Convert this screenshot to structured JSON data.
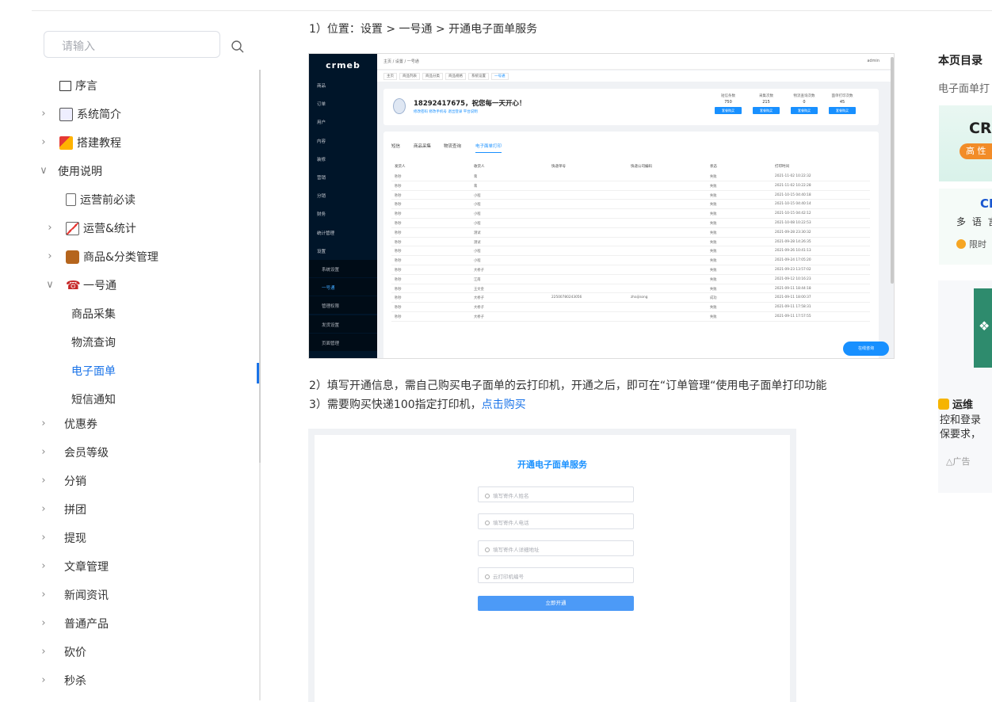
{
  "search": {
    "placeholder": "请输入"
  },
  "sidebar": {
    "items": [
      {
        "label": "序言",
        "icon": "book-icon",
        "chevron": ""
      },
      {
        "label": "系统简介",
        "icon": "document-icon",
        "chevron": ">"
      },
      {
        "label": "搭建教程",
        "icon": "construction-icon",
        "chevron": ">"
      },
      {
        "label": "使用说明",
        "icon": "",
        "chevron": "v"
      },
      {
        "label": "运营前必读",
        "icon": "page-icon",
        "chevron": ""
      },
      {
        "label": "运营&统计",
        "icon": "chart-icon",
        "chevron": ">"
      },
      {
        "label": "商品&分类管理",
        "icon": "box-icon",
        "chevron": ">"
      },
      {
        "label": "一号通",
        "icon": "phone-icon",
        "chevron": "v"
      },
      {
        "label": "商品采集",
        "icon": "",
        "chevron": ""
      },
      {
        "label": "物流查询",
        "icon": "",
        "chevron": ""
      },
      {
        "label": "电子面单",
        "icon": "",
        "chevron": "",
        "active": true
      },
      {
        "label": "短信通知",
        "icon": "",
        "chevron": ""
      },
      {
        "label": "优惠券",
        "icon": "",
        "chevron": ">"
      },
      {
        "label": "会员等级",
        "icon": "",
        "chevron": ">"
      },
      {
        "label": "分销",
        "icon": "",
        "chevron": ">"
      },
      {
        "label": "拼团",
        "icon": "",
        "chevron": ">"
      },
      {
        "label": "提现",
        "icon": "",
        "chevron": ">"
      },
      {
        "label": "文章管理",
        "icon": "",
        "chevron": ">"
      },
      {
        "label": "新闻资讯",
        "icon": "",
        "chevron": ">"
      },
      {
        "label": "普通产品",
        "icon": "",
        "chevron": ">"
      },
      {
        "label": "砍价",
        "icon": "",
        "chevron": ">"
      },
      {
        "label": "秒杀",
        "icon": "",
        "chevron": ">"
      }
    ]
  },
  "content": {
    "step1": "1）位置：设置 > 一号通 > 开通电子面单服务",
    "step2": "2）填写开通信息，需自己购买电子面单的云打印机，开通之后，即可在“订单管理“使用电子面单打印功能",
    "step3_prefix": "3）需要购买快递100指定打印机，",
    "step3_link": "点击购买"
  },
  "screenshot": {
    "logo": "crmeb",
    "breadcrumb": "主页 / 设置 / 一号通",
    "user": "admin",
    "tabs": [
      "主页",
      "商品列表",
      "商品分类",
      "商品规格",
      "系统设置",
      "一号通"
    ],
    "menu": [
      "商品",
      "订单",
      "用户",
      "内容",
      "装修",
      "营销",
      "分销",
      "财务",
      "统计管理",
      "设置",
      "系统设置",
      "一号通",
      "管理权限",
      "发货设置",
      "页面管理",
      "维护"
    ],
    "greeting": "18292417675，祝您每一天开心！",
    "links": "修改密码  修改手机号  退出登录  平台说明",
    "stats": [
      {
        "label": "短信条数",
        "value": "750",
        "button": "套餐购买"
      },
      {
        "label": "采集次数",
        "value": "215",
        "button": "套餐购买"
      },
      {
        "label": "物流查询次数",
        "value": "0",
        "button": "套餐购买"
      },
      {
        "label": "面单打印次数",
        "value": "45",
        "button": "套餐购买"
      }
    ],
    "content_tabs": [
      "短信",
      "商品采集",
      "物流查询",
      "电子面单打印"
    ],
    "table_headers": [
      "发货人",
      "收货人",
      "快递单号",
      "快递公司编码",
      "状态",
      "打印时间"
    ],
    "rows": [
      [
        "秒秒",
        "蒋",
        "",
        "",
        "失败",
        "2021-11-02 10:22:32"
      ],
      [
        "秒秒",
        "蒋",
        "",
        "",
        "失败",
        "2021-11-02 10:22:28"
      ],
      [
        "秒秒",
        "小程",
        "",
        "",
        "失败",
        "2021-10-15 04:40:18"
      ],
      [
        "秒秒",
        "小程",
        "",
        "",
        "失败",
        "2021-10-15 04:40:14"
      ],
      [
        "秒秒",
        "小程",
        "",
        "",
        "失败",
        "2021-10-15 04:42:12"
      ],
      [
        "秒秒",
        "小程",
        "",
        "",
        "失败",
        "2021-10-08 10:22:53"
      ],
      [
        "秒秒",
        "测试",
        "",
        "",
        "失败",
        "2021-09-28 23:30:32"
      ],
      [
        "秒秒",
        "测试",
        "",
        "",
        "失败",
        "2021-09-28 14:26:35"
      ],
      [
        "秒秒",
        "小程",
        "",
        "",
        "失败",
        "2021-09-26 10:41:13"
      ],
      [
        "秒秒",
        "小程",
        "",
        "",
        "失败",
        "2021-09-24 17:05:20"
      ],
      [
        "秒秒",
        "大桥子",
        "",
        "",
        "失败",
        "2021-09-23 13:57:02"
      ],
      [
        "秒秒",
        "江南",
        "",
        "",
        "失败",
        "2021-09-12 10:16:23"
      ],
      [
        "秒秒",
        "王文金",
        "",
        "",
        "失败",
        "2021-09-11 18:44:18"
      ],
      [
        "秒秒",
        "大桥子",
        "22500780243056",
        "zhaijisong",
        "成功",
        "2021-09-11 18:00:37"
      ],
      [
        "秒秒",
        "大桥子",
        "",
        "",
        "失败",
        "2021-09-11 17:58:31"
      ],
      [
        "秒秒",
        "大桥子",
        "",
        "",
        "失败",
        "2021-09-11 17:57:55"
      ]
    ],
    "online": "在线咨询"
  },
  "form": {
    "title": "开通电子面单服务",
    "fields": [
      "填写寄件人姓名",
      "填写寄件人电话",
      "填写寄件人详细地址",
      "云打印机编号"
    ],
    "submit": "立即开通"
  },
  "right": {
    "toc_title": "本页目录",
    "toc_item": "电子面单打",
    "ad1_title": "CR",
    "ad1_pill": "高 性",
    "ad2_title": "CI",
    "ad2_sub": "多 语 言 |",
    "ad2_link": "限时",
    "ad3_heading": "运维",
    "ad3_desc1": "控和登录",
    "ad3_desc2": "保要求，",
    "ad3_ad": "广告"
  }
}
